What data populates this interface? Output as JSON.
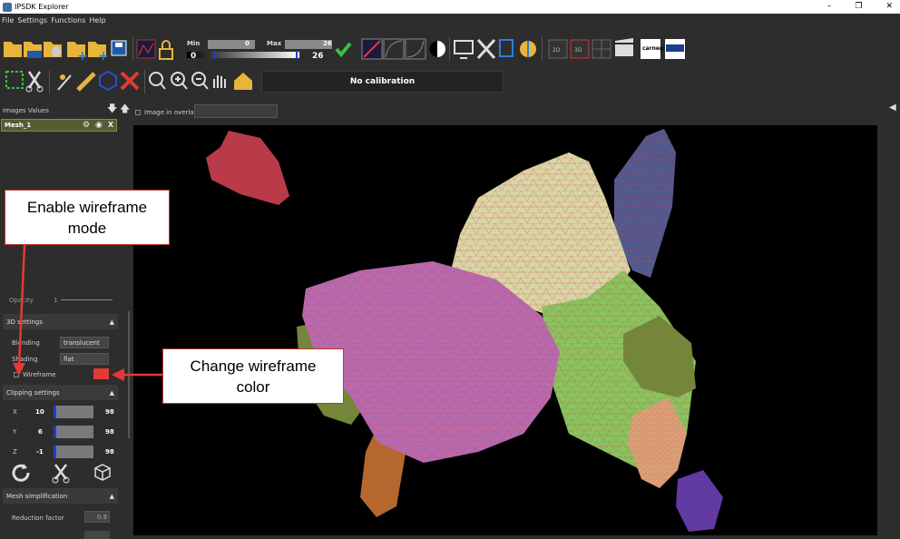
{
  "window": {
    "title": "IPSDK Explorer",
    "minimize": "–",
    "restore": "❐",
    "close": "✕"
  },
  "menu": [
    "File",
    "Settings",
    "Functions",
    "Help"
  ],
  "toolbar": {
    "min_label": "Min",
    "min_value": "0",
    "max_label": "Max",
    "max_value": "26",
    "min_display": "0",
    "max_display": "26",
    "btn_2d": "2D",
    "btn_3d": "3D",
    "calibration": "No calibration"
  },
  "left_panel": {
    "tab_images": "Images",
    "tab_values": "Values",
    "mesh_name": "Mesh_1",
    "mesh_close": "X",
    "opacity_label": "Opacity",
    "opacity_value": "1",
    "section_3d": "3D settings",
    "blending_label": "Blending",
    "blending_value": "translucent",
    "shading_label": "Shading",
    "shading_value": "flat",
    "wireframe_label": "Wireframe",
    "section_clipping": "Clipping settings",
    "clip": [
      {
        "axis": "X",
        "min": "10",
        "max": "98"
      },
      {
        "axis": "Y",
        "min": "6",
        "max": "98"
      },
      {
        "axis": "Z",
        "min": "-1",
        "max": "98"
      }
    ],
    "section_mesh_simplification": "Mesh simplification",
    "reduction_label": "Reduction factor",
    "reduction_value": "0.9"
  },
  "overlay": {
    "label": "Image in overlay"
  },
  "annotations": {
    "enable_wireframe": "Enable wireframe mode",
    "change_wireframe_color": "Change wireframe color"
  },
  "colors": {
    "wireframe": "#e53935",
    "accent": "#1c3fd0",
    "mesh_row": "#575c30"
  }
}
